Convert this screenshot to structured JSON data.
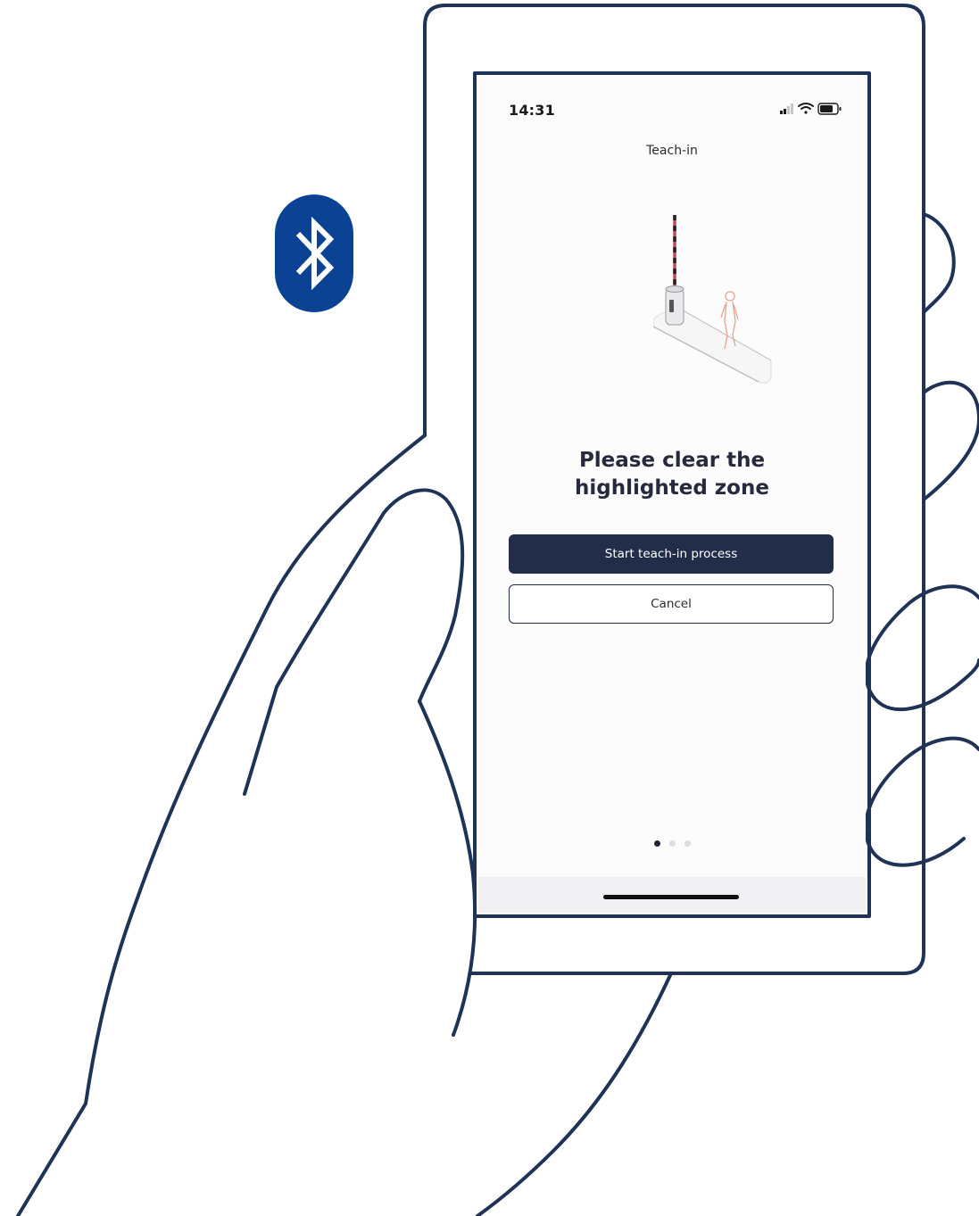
{
  "colors": {
    "outline": "#1e3356",
    "primary_button": "#222d4a",
    "bluetooth_badge": "#0b4294",
    "screen_background": "#fdfcfd"
  },
  "icons": {
    "bluetooth": "bluetooth-icon",
    "signal": "cellular-signal-icon",
    "wifi": "wifi-icon",
    "battery": "battery-icon"
  },
  "status_bar": {
    "time": "14:31"
  },
  "screen": {
    "nav_title": "Teach-in",
    "heading_line1": "Please clear the",
    "heading_line2": "highlighted zone",
    "primary_button_label": "Start teach-in process",
    "secondary_button_label": "Cancel",
    "pager": {
      "total_pages": 3,
      "current_page": 1
    }
  }
}
